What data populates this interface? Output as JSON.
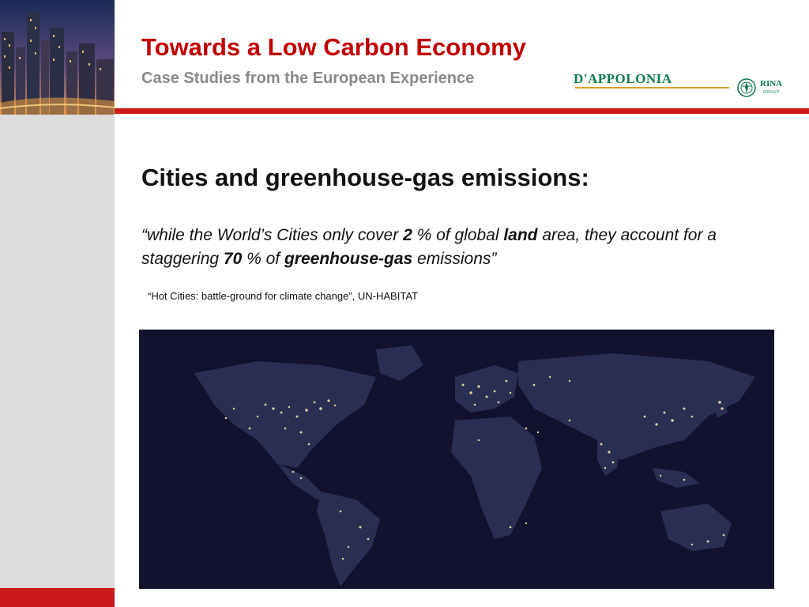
{
  "header": {
    "title": "Towards a Low Carbon Economy",
    "subtitle": "Case Studies from the European Experience",
    "logo": {
      "brand": "D'APPOLONIA",
      "partner": "RINA",
      "partner_suffix": "GROUP"
    }
  },
  "slide": {
    "heading": "Cities and greenhouse-gas emissions:",
    "quote": {
      "part1": "“while the World’s Cities only cover ",
      "num1": "2",
      "part2": " % of global ",
      "word1": "land",
      "part3": " area, they account for a staggering ",
      "num2": "70",
      "part4": " % of ",
      "word2": "greenhouse-gas",
      "part5": " emissions”"
    },
    "source": "“Hot Cities: battle-ground for climate change”, UN-HABITAT"
  },
  "colors": {
    "accent_red": "#cc1a1a",
    "title_red": "#c00000",
    "subtitle_gray": "#8a8a8a",
    "side_gray": "#dcdcdc",
    "logo_green": "#0d7a4b",
    "map_background": "#12122e"
  },
  "icons": {
    "header_image": "city-skyline-photo",
    "map_image": "world-night-lights-map",
    "partner_mark": "rina-emblem-icon"
  }
}
